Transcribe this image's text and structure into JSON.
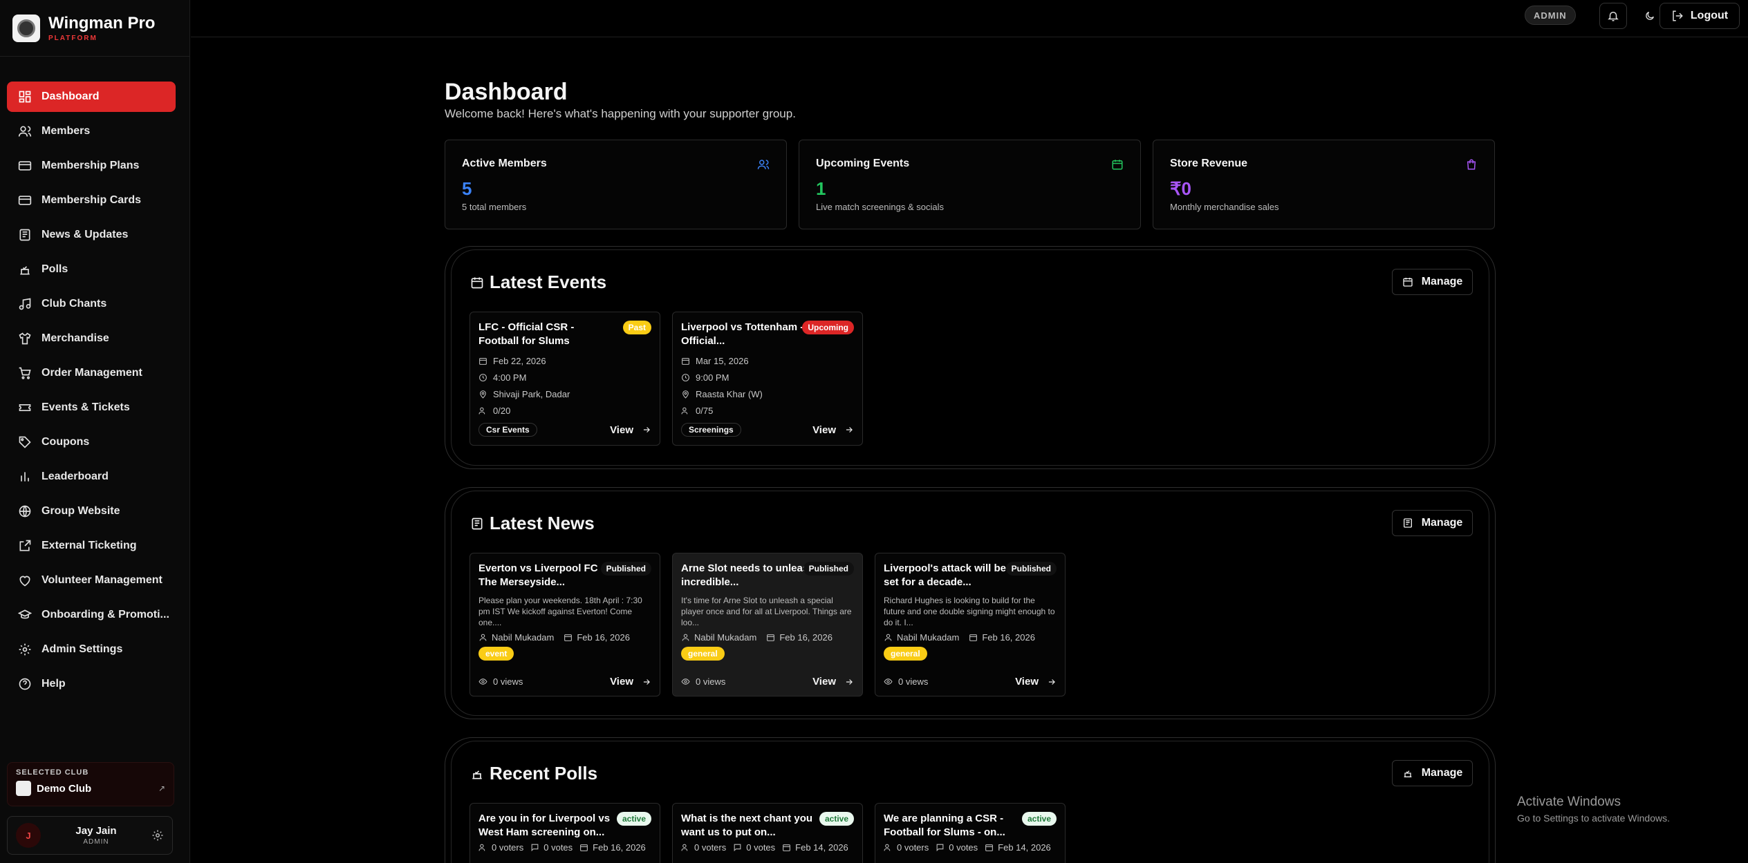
{
  "brand": {
    "name": "Wingman Pro",
    "sub": "PLATFORM"
  },
  "sidebar": {
    "items": [
      {
        "label": "Dashboard",
        "icon": "grid-icon",
        "active": true
      },
      {
        "label": "Members",
        "icon": "users-icon"
      },
      {
        "label": "Membership Plans",
        "icon": "card-icon"
      },
      {
        "label": "Membership Cards",
        "icon": "card-icon"
      },
      {
        "label": "News & Updates",
        "icon": "newspaper-icon"
      },
      {
        "label": "Polls",
        "icon": "vote-icon"
      },
      {
        "label": "Club Chants",
        "icon": "music-icon"
      },
      {
        "label": "Merchandise",
        "icon": "shirt-icon"
      },
      {
        "label": "Order Management",
        "icon": "cart-icon"
      },
      {
        "label": "Events & Tickets",
        "icon": "ticket-icon"
      },
      {
        "label": "Coupons",
        "icon": "tag-icon"
      },
      {
        "label": "Leaderboard",
        "icon": "bar-chart-icon"
      },
      {
        "label": "Group Website",
        "icon": "globe-icon"
      },
      {
        "label": "External Ticketing",
        "icon": "external-link-icon"
      },
      {
        "label": "Volunteer Management",
        "icon": "heart-icon"
      },
      {
        "label": "Onboarding & Promoti...",
        "icon": "graduation-cap-icon"
      },
      {
        "label": "Admin Settings",
        "icon": "gear-icon"
      },
      {
        "label": "Help",
        "icon": "help-circle-icon"
      }
    ],
    "club": {
      "caption": "SELECTED CLUB",
      "name": "Demo Club"
    },
    "user": {
      "initial": "J",
      "name": "Jay Jain",
      "role": "ADMIN"
    }
  },
  "topbar": {
    "role_badge": "ADMIN",
    "logout": "Logout"
  },
  "main": {
    "title": "Dashboard",
    "subtitle": "Welcome back! Here's what's happening with your supporter group."
  },
  "stats": [
    {
      "title": "Active Members",
      "value": "5",
      "note": "5 total members",
      "color": "#3b82f6"
    },
    {
      "title": "Upcoming Events",
      "value": "1",
      "note": "Live match screenings & socials",
      "color": "#22c55e"
    },
    {
      "title": "Store Revenue",
      "value": "₹0",
      "note": "Monthly merchandise sales",
      "color": "#a855f7"
    }
  ],
  "events": {
    "title": "Latest Events",
    "manage": "Manage",
    "items": [
      {
        "title": "LFC - Official CSR - Football for Slums",
        "status": "Past",
        "date": "Feb 22, 2026",
        "time": "4:00 PM",
        "location": "Shivaji Park, Dadar",
        "capacity": "0/20",
        "tag": "Csr Events",
        "view": "View"
      },
      {
        "title": "Liverpool vs Tottenham - Official...",
        "status": "Upcoming",
        "date": "Mar 15, 2026",
        "time": "9:00 PM",
        "location": "Raasta Khar (W)",
        "capacity": "0/75",
        "tag": "Screenings",
        "view": "View"
      }
    ]
  },
  "news": {
    "title": "Latest News",
    "manage": "Manage",
    "items": [
      {
        "title": "Everton vs Liverpool FC - The Merseyside...",
        "status": "Published",
        "excerpt": "Please plan your weekends. 18th April : 7:30 pm IST We kickoff against Everton! Come one....",
        "author": "Nabil Mukadam",
        "date": "Feb 16, 2026",
        "tag": "event",
        "views": "0 views",
        "view": "View"
      },
      {
        "title": "Arne Slot needs to unleash incredible...",
        "status": "Published",
        "excerpt": "It's time for Arne Slot to unleash a special player once and for all at Liverpool. Things are loo...",
        "author": "Nabil Mukadam",
        "date": "Feb 16, 2026",
        "tag": "general",
        "views": "0 views",
        "view": "View"
      },
      {
        "title": "Liverpool's attack will be set for a decade...",
        "status": "Published",
        "excerpt": "Richard Hughes is looking to build for the future and one double signing might enough to do it. I...",
        "author": "Nabil Mukadam",
        "date": "Feb 16, 2026",
        "tag": "general",
        "views": "0 views",
        "view": "View"
      }
    ]
  },
  "polls": {
    "title": "Recent Polls",
    "manage": "Manage",
    "items": [
      {
        "title": "Are you in for Liverpool vs West Ham screening on...",
        "status": "active",
        "voters": "0 voters",
        "votes": "0 votes",
        "date": "Feb 16, 2026"
      },
      {
        "title": "What is the next chant you want us to put on...",
        "status": "active",
        "voters": "0 voters",
        "votes": "0 votes",
        "date": "Feb 14, 2026"
      },
      {
        "title": "We are planning a CSR - Football for Slums - on...",
        "status": "active",
        "voters": "0 voters",
        "votes": "0 votes",
        "date": "Feb 14, 2026"
      }
    ]
  },
  "watermark": {
    "line1": "Activate Windows",
    "line2": "Go to Settings to activate Windows."
  }
}
